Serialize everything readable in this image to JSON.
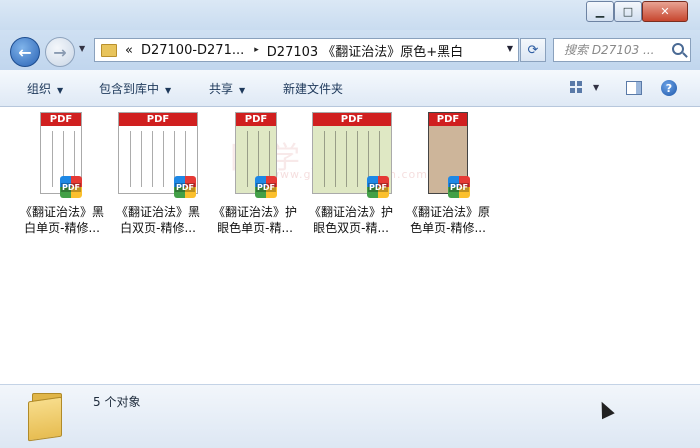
{
  "window": {
    "minimize_glyph": "▁",
    "maximize_glyph": "□",
    "close_glyph": "✕"
  },
  "address": {
    "prefix": "«",
    "crumb1": "D27100-D271...",
    "separator": "▸",
    "crumb2": "D27103 《翻证治法》原色+黑白"
  },
  "search": {
    "placeholder": "搜索 D27103 ..."
  },
  "toolbar": {
    "organize": "组织",
    "include_in_library": "包含到库中",
    "share": "共享",
    "new_folder": "新建文件夹"
  },
  "files": [
    {
      "line1": "《翻证治法》黑",
      "line2": "白单页-精修...",
      "thumb_bg": "#ffffff",
      "badge": "PDF"
    },
    {
      "line1": "《翻证治法》黑",
      "line2": "白双页-精修...",
      "thumb_bg": "#ffffff",
      "badge": "PDF"
    },
    {
      "line1": "《翻证治法》护",
      "line2": "眼色单页-精...",
      "thumb_bg": "#dfe8c4",
      "badge": "PDF"
    },
    {
      "line1": "《翻证治法》护",
      "line2": "眼色双页-精...",
      "thumb_bg": "#dfe8c4",
      "badge": "PDF"
    },
    {
      "line1": "《翻证治法》原",
      "line2": "色单页-精修...",
      "thumb_bg": "#cdb59a",
      "badge": "PDF"
    }
  ],
  "thumb_header": "PDF",
  "status": {
    "count": "5 个对象"
  }
}
